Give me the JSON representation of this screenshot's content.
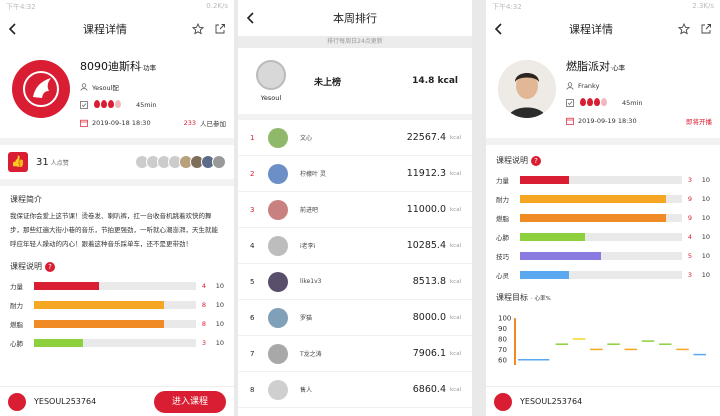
{
  "left": {
    "status_time": "下午4:32",
    "status_right": "0.2K/s",
    "nav_title": "课程详情",
    "course": {
      "name": "8090迪斯科",
      "type": "·功率",
      "brand": "Yesoul配",
      "duration": "45min",
      "datetime": "2019-09-18  18:30",
      "joined_count": "233",
      "joined_suffix": "人已参加"
    },
    "likes": {
      "count": "31",
      "suffix": "人点赞"
    },
    "intro_title": "课程简介",
    "intro_text": "我保证你会爱上这节课！烫卷发、喇叭裤，扛一台收音机跳着欢快的舞步，那些红遍大街小巷的音乐，节拍更强劲，一听就心潮澎湃，天生就能呼应年轻人躁动的内心！跟着这种音乐踩单车，还不是更带劲！",
    "desc_title": "课程说明",
    "bars": [
      {
        "label": "力量",
        "value": 4,
        "max": "10",
        "color": "#d91d32"
      },
      {
        "label": "耐力",
        "value": 8,
        "max": "10",
        "color": "#f5a623"
      },
      {
        "label": "燃脂",
        "value": 8,
        "max": "10",
        "color": "#f08a24"
      },
      {
        "label": "心肺",
        "value": 3,
        "max": "10",
        "color": "#8cd13d"
      }
    ],
    "bottom": {
      "name": "YESOUL253764",
      "enter_label": "进入课程"
    }
  },
  "middle": {
    "nav_title": "本周排行",
    "notice": "排行每周日24点更新",
    "me": {
      "name": "Yesoul",
      "status": "未上榜",
      "kcal": "14.8 kcal"
    },
    "unit": "kcal",
    "rows": [
      {
        "rank": "1",
        "name": "文心",
        "kcal": "22567.4"
      },
      {
        "rank": "2",
        "name": "柠檬叶 灵",
        "kcal": "11912.3"
      },
      {
        "rank": "3",
        "name": "前进吧",
        "kcal": "11000.0"
      },
      {
        "rank": "4",
        "name": "i老李i",
        "kcal": "10285.4"
      },
      {
        "rank": "5",
        "name": "like1v3",
        "kcal": "8513.8"
      },
      {
        "rank": "6",
        "name": "罗猫",
        "kcal": "8000.0"
      },
      {
        "rank": "7",
        "name": "T龙之涛",
        "kcal": "7906.1"
      },
      {
        "rank": "8",
        "name": "售人",
        "kcal": "6860.4"
      }
    ]
  },
  "right": {
    "status_time": "下午4:32",
    "status_right": "2.3K/s",
    "nav_title": "课程详情",
    "course": {
      "name": "燃脂派对",
      "type": "·心率",
      "coach": "Franky",
      "duration": "45min",
      "datetime": "2019-09-19  18:30",
      "status": "即将开播"
    },
    "desc_title": "课程说明",
    "bars": [
      {
        "label": "力量",
        "value": 3,
        "max": "10",
        "color": "#d91d32"
      },
      {
        "label": "耐力",
        "value": 9,
        "max": "10",
        "color": "#f5a623"
      },
      {
        "label": "燃脂",
        "value": 9,
        "max": "10",
        "color": "#f08a24"
      },
      {
        "label": "心肺",
        "value": 4,
        "max": "10",
        "color": "#8cd13d"
      },
      {
        "label": "技巧",
        "value": 5,
        "max": "10",
        "color": "#8a7be0"
      },
      {
        "label": "心灵",
        "value": 3,
        "max": "10",
        "color": "#5aa8ef"
      }
    ],
    "target_title": "课程目标",
    "target_unit": "· 心率%",
    "chart_data": {
      "type": "line",
      "yticks": [
        "100",
        "90",
        "80",
        "70",
        "60"
      ],
      "ylim": [
        55,
        105
      ],
      "segments": [
        {
          "x0": 0,
          "x1": 2,
          "y": 60,
          "color": "#5aa8ef"
        },
        {
          "x0": 2.4,
          "x1": 3.2,
          "y": 75,
          "color": "#8cd13d"
        },
        {
          "x0": 3.5,
          "x1": 4.3,
          "y": 80,
          "color": "#f5d623"
        },
        {
          "x0": 4.6,
          "x1": 5.4,
          "y": 70,
          "color": "#f5a623"
        },
        {
          "x0": 5.7,
          "x1": 6.5,
          "y": 75,
          "color": "#8cd13d"
        },
        {
          "x0": 6.8,
          "x1": 7.6,
          "y": 70,
          "color": "#f5a623"
        },
        {
          "x0": 7.9,
          "x1": 8.7,
          "y": 78,
          "color": "#8cd13d"
        },
        {
          "x0": 9,
          "x1": 9.8,
          "y": 75,
          "color": "#8cd13d"
        },
        {
          "x0": 10.1,
          "x1": 10.9,
          "y": 70,
          "color": "#f5a623"
        },
        {
          "x0": 11.2,
          "x1": 12,
          "y": 65,
          "color": "#5aa8ef"
        }
      ],
      "xlim": [
        0,
        12
      ]
    },
    "bottom": {
      "name": "YESOUL253764"
    }
  }
}
